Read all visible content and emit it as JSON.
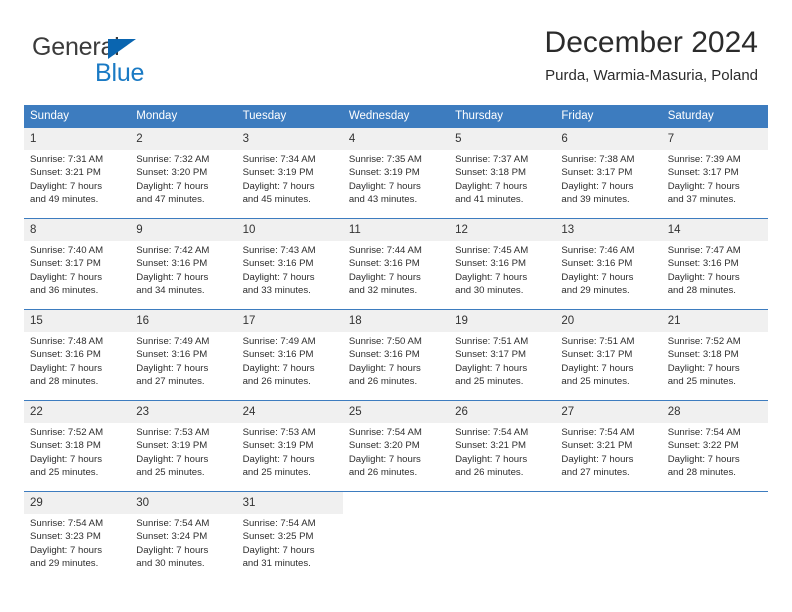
{
  "brand": {
    "name_part1": "General",
    "name_part2": "Blue",
    "triangle_icon": "triangle-icon",
    "accent_color": "#1a7ac4",
    "dark_color": "#3b3b3b"
  },
  "header": {
    "title": "December 2024",
    "subtitle": "Purda, Warmia-Masuria, Poland"
  },
  "theme": {
    "header_bg": "#3d7cbf",
    "header_text": "#ffffff",
    "daynum_bg": "#f0f0f0",
    "body_text": "#2e2e2e"
  },
  "weekday_headers": [
    "Sunday",
    "Monday",
    "Tuesday",
    "Wednesday",
    "Thursday",
    "Friday",
    "Saturday"
  ],
  "weeks": [
    [
      {
        "day": "1",
        "sunrise": "Sunrise: 7:31 AM",
        "sunset": "Sunset: 3:21 PM",
        "daylight_line1": "Daylight: 7 hours",
        "daylight_line2": "and 49 minutes."
      },
      {
        "day": "2",
        "sunrise": "Sunrise: 7:32 AM",
        "sunset": "Sunset: 3:20 PM",
        "daylight_line1": "Daylight: 7 hours",
        "daylight_line2": "and 47 minutes."
      },
      {
        "day": "3",
        "sunrise": "Sunrise: 7:34 AM",
        "sunset": "Sunset: 3:19 PM",
        "daylight_line1": "Daylight: 7 hours",
        "daylight_line2": "and 45 minutes."
      },
      {
        "day": "4",
        "sunrise": "Sunrise: 7:35 AM",
        "sunset": "Sunset: 3:19 PM",
        "daylight_line1": "Daylight: 7 hours",
        "daylight_line2": "and 43 minutes."
      },
      {
        "day": "5",
        "sunrise": "Sunrise: 7:37 AM",
        "sunset": "Sunset: 3:18 PM",
        "daylight_line1": "Daylight: 7 hours",
        "daylight_line2": "and 41 minutes."
      },
      {
        "day": "6",
        "sunrise": "Sunrise: 7:38 AM",
        "sunset": "Sunset: 3:17 PM",
        "daylight_line1": "Daylight: 7 hours",
        "daylight_line2": "and 39 minutes."
      },
      {
        "day": "7",
        "sunrise": "Sunrise: 7:39 AM",
        "sunset": "Sunset: 3:17 PM",
        "daylight_line1": "Daylight: 7 hours",
        "daylight_line2": "and 37 minutes."
      }
    ],
    [
      {
        "day": "8",
        "sunrise": "Sunrise: 7:40 AM",
        "sunset": "Sunset: 3:17 PM",
        "daylight_line1": "Daylight: 7 hours",
        "daylight_line2": "and 36 minutes."
      },
      {
        "day": "9",
        "sunrise": "Sunrise: 7:42 AM",
        "sunset": "Sunset: 3:16 PM",
        "daylight_line1": "Daylight: 7 hours",
        "daylight_line2": "and 34 minutes."
      },
      {
        "day": "10",
        "sunrise": "Sunrise: 7:43 AM",
        "sunset": "Sunset: 3:16 PM",
        "daylight_line1": "Daylight: 7 hours",
        "daylight_line2": "and 33 minutes."
      },
      {
        "day": "11",
        "sunrise": "Sunrise: 7:44 AM",
        "sunset": "Sunset: 3:16 PM",
        "daylight_line1": "Daylight: 7 hours",
        "daylight_line2": "and 32 minutes."
      },
      {
        "day": "12",
        "sunrise": "Sunrise: 7:45 AM",
        "sunset": "Sunset: 3:16 PM",
        "daylight_line1": "Daylight: 7 hours",
        "daylight_line2": "and 30 minutes."
      },
      {
        "day": "13",
        "sunrise": "Sunrise: 7:46 AM",
        "sunset": "Sunset: 3:16 PM",
        "daylight_line1": "Daylight: 7 hours",
        "daylight_line2": "and 29 minutes."
      },
      {
        "day": "14",
        "sunrise": "Sunrise: 7:47 AM",
        "sunset": "Sunset: 3:16 PM",
        "daylight_line1": "Daylight: 7 hours",
        "daylight_line2": "and 28 minutes."
      }
    ],
    [
      {
        "day": "15",
        "sunrise": "Sunrise: 7:48 AM",
        "sunset": "Sunset: 3:16 PM",
        "daylight_line1": "Daylight: 7 hours",
        "daylight_line2": "and 28 minutes."
      },
      {
        "day": "16",
        "sunrise": "Sunrise: 7:49 AM",
        "sunset": "Sunset: 3:16 PM",
        "daylight_line1": "Daylight: 7 hours",
        "daylight_line2": "and 27 minutes."
      },
      {
        "day": "17",
        "sunrise": "Sunrise: 7:49 AM",
        "sunset": "Sunset: 3:16 PM",
        "daylight_line1": "Daylight: 7 hours",
        "daylight_line2": "and 26 minutes."
      },
      {
        "day": "18",
        "sunrise": "Sunrise: 7:50 AM",
        "sunset": "Sunset: 3:16 PM",
        "daylight_line1": "Daylight: 7 hours",
        "daylight_line2": "and 26 minutes."
      },
      {
        "day": "19",
        "sunrise": "Sunrise: 7:51 AM",
        "sunset": "Sunset: 3:17 PM",
        "daylight_line1": "Daylight: 7 hours",
        "daylight_line2": "and 25 minutes."
      },
      {
        "day": "20",
        "sunrise": "Sunrise: 7:51 AM",
        "sunset": "Sunset: 3:17 PM",
        "daylight_line1": "Daylight: 7 hours",
        "daylight_line2": "and 25 minutes."
      },
      {
        "day": "21",
        "sunrise": "Sunrise: 7:52 AM",
        "sunset": "Sunset: 3:18 PM",
        "daylight_line1": "Daylight: 7 hours",
        "daylight_line2": "and 25 minutes."
      }
    ],
    [
      {
        "day": "22",
        "sunrise": "Sunrise: 7:52 AM",
        "sunset": "Sunset: 3:18 PM",
        "daylight_line1": "Daylight: 7 hours",
        "daylight_line2": "and 25 minutes."
      },
      {
        "day": "23",
        "sunrise": "Sunrise: 7:53 AM",
        "sunset": "Sunset: 3:19 PM",
        "daylight_line1": "Daylight: 7 hours",
        "daylight_line2": "and 25 minutes."
      },
      {
        "day": "24",
        "sunrise": "Sunrise: 7:53 AM",
        "sunset": "Sunset: 3:19 PM",
        "daylight_line1": "Daylight: 7 hours",
        "daylight_line2": "and 25 minutes."
      },
      {
        "day": "25",
        "sunrise": "Sunrise: 7:54 AM",
        "sunset": "Sunset: 3:20 PM",
        "daylight_line1": "Daylight: 7 hours",
        "daylight_line2": "and 26 minutes."
      },
      {
        "day": "26",
        "sunrise": "Sunrise: 7:54 AM",
        "sunset": "Sunset: 3:21 PM",
        "daylight_line1": "Daylight: 7 hours",
        "daylight_line2": "and 26 minutes."
      },
      {
        "day": "27",
        "sunrise": "Sunrise: 7:54 AM",
        "sunset": "Sunset: 3:21 PM",
        "daylight_line1": "Daylight: 7 hours",
        "daylight_line2": "and 27 minutes."
      },
      {
        "day": "28",
        "sunrise": "Sunrise: 7:54 AM",
        "sunset": "Sunset: 3:22 PM",
        "daylight_line1": "Daylight: 7 hours",
        "daylight_line2": "and 28 minutes."
      }
    ],
    [
      {
        "day": "29",
        "sunrise": "Sunrise: 7:54 AM",
        "sunset": "Sunset: 3:23 PM",
        "daylight_line1": "Daylight: 7 hours",
        "daylight_line2": "and 29 minutes."
      },
      {
        "day": "30",
        "sunrise": "Sunrise: 7:54 AM",
        "sunset": "Sunset: 3:24 PM",
        "daylight_line1": "Daylight: 7 hours",
        "daylight_line2": "and 30 minutes."
      },
      {
        "day": "31",
        "sunrise": "Sunrise: 7:54 AM",
        "sunset": "Sunset: 3:25 PM",
        "daylight_line1": "Daylight: 7 hours",
        "daylight_line2": "and 31 minutes."
      },
      {
        "day": "",
        "sunrise": "",
        "sunset": "",
        "daylight_line1": "",
        "daylight_line2": ""
      },
      {
        "day": "",
        "sunrise": "",
        "sunset": "",
        "daylight_line1": "",
        "daylight_line2": ""
      },
      {
        "day": "",
        "sunrise": "",
        "sunset": "",
        "daylight_line1": "",
        "daylight_line2": ""
      },
      {
        "day": "",
        "sunrise": "",
        "sunset": "",
        "daylight_line1": "",
        "daylight_line2": ""
      }
    ]
  ]
}
